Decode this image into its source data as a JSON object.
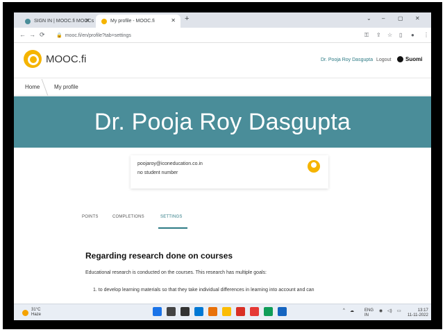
{
  "browser": {
    "tabs": [
      {
        "label": "SIGN IN | MOOC.fi MOOCs",
        "color": "#4a8d99"
      },
      {
        "label": "My profile - MOOC.fi",
        "color": "#f5b400"
      }
    ],
    "new_tab_glyph": "+",
    "address": "mooc.fi/en/profile?tab=settings"
  },
  "site": {
    "logo_text": "MOOC.fi",
    "user_link": "Dr. Pooja Roy Dasgupta",
    "logout": "Logout",
    "language": "Suomi"
  },
  "breadcrumb": {
    "home": "Home",
    "current": "My profile"
  },
  "profile": {
    "name": "Dr. Pooja Roy Dasgupta",
    "email": "poojaroy@iconeducation.co.in",
    "student_number": "no student number"
  },
  "tabs": {
    "points": "POINTS",
    "completions": "COMPLETIONS",
    "settings": "SETTINGS"
  },
  "content": {
    "title": "Regarding research done on courses",
    "paragraph": "Educational research is conducted on the courses. This research has multiple goals:",
    "item_1": "1. to develop learning materials so that they take individual differences in learning into account and can"
  },
  "taskbar": {
    "temperature": "31°C",
    "condition": "Haze",
    "lang": "ENG",
    "region": "IN",
    "time": "13:17",
    "date": "11-11-2022",
    "app_colors": [
      "#1a73e8",
      "#444",
      "#333",
      "#0078d4",
      "#e8710a",
      "#fbbc04",
      "#d93025",
      "#e53935",
      "#0f9d58",
      "#1565c0"
    ]
  },
  "colors": {
    "banner": "#4a8d99",
    "accent": "#2c7a84",
    "logo": "#f5b400"
  }
}
